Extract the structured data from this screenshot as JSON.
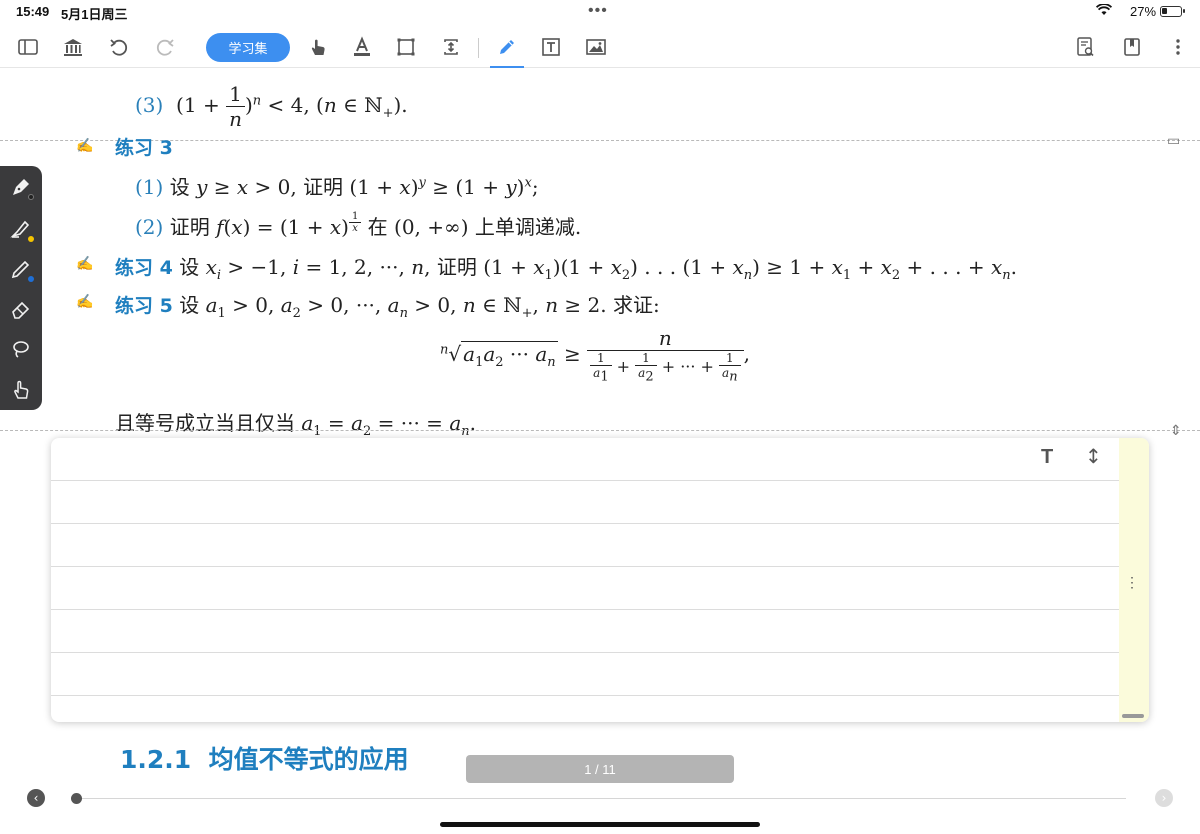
{
  "status_bar": {
    "time": "15:49",
    "date": "5月1日周三",
    "battery_percent": "27%",
    "battery_level": 0.27
  },
  "toolbar": {
    "study_set_label": "学习集",
    "icons": [
      "sidebar-icon",
      "library-icon",
      "undo-icon",
      "redo-icon",
      "hand-icon",
      "text-highlight-icon",
      "crop-icon",
      "expand-icon",
      "pen-icon",
      "textbox-icon",
      "image-icon",
      "search-doc-icon",
      "bookmark-icon",
      "more-icon"
    ]
  },
  "content": {
    "item3_label": "(3)",
    "ex3_title": "练习 3",
    "ex3_item1_label": "(1)",
    "ex3_item1_text1": "设",
    "ex3_item1_text2": "证明",
    "ex3_item2_label": "(2)",
    "ex3_item2_text1": "证明",
    "ex3_item2_text2": "在",
    "ex3_item2_text3": "上单调递减.",
    "ex4_title": "练习 4",
    "ex4_text1": "设",
    "ex4_text2": "证明",
    "ex5_title": "练习 5",
    "ex5_text1": "设",
    "ex5_text2": "求证:",
    "equality_text": "且等号成立当且仅当"
  },
  "section": {
    "number": "1.2.1",
    "title": "均值不等式的应用"
  },
  "page_indicator": "1 / 11",
  "colors": {
    "accent": "#3d8ff0",
    "heading": "#1f7fbf",
    "pen_dots": [
      "#222222",
      "#f5c400",
      "#1f6fd6"
    ]
  }
}
